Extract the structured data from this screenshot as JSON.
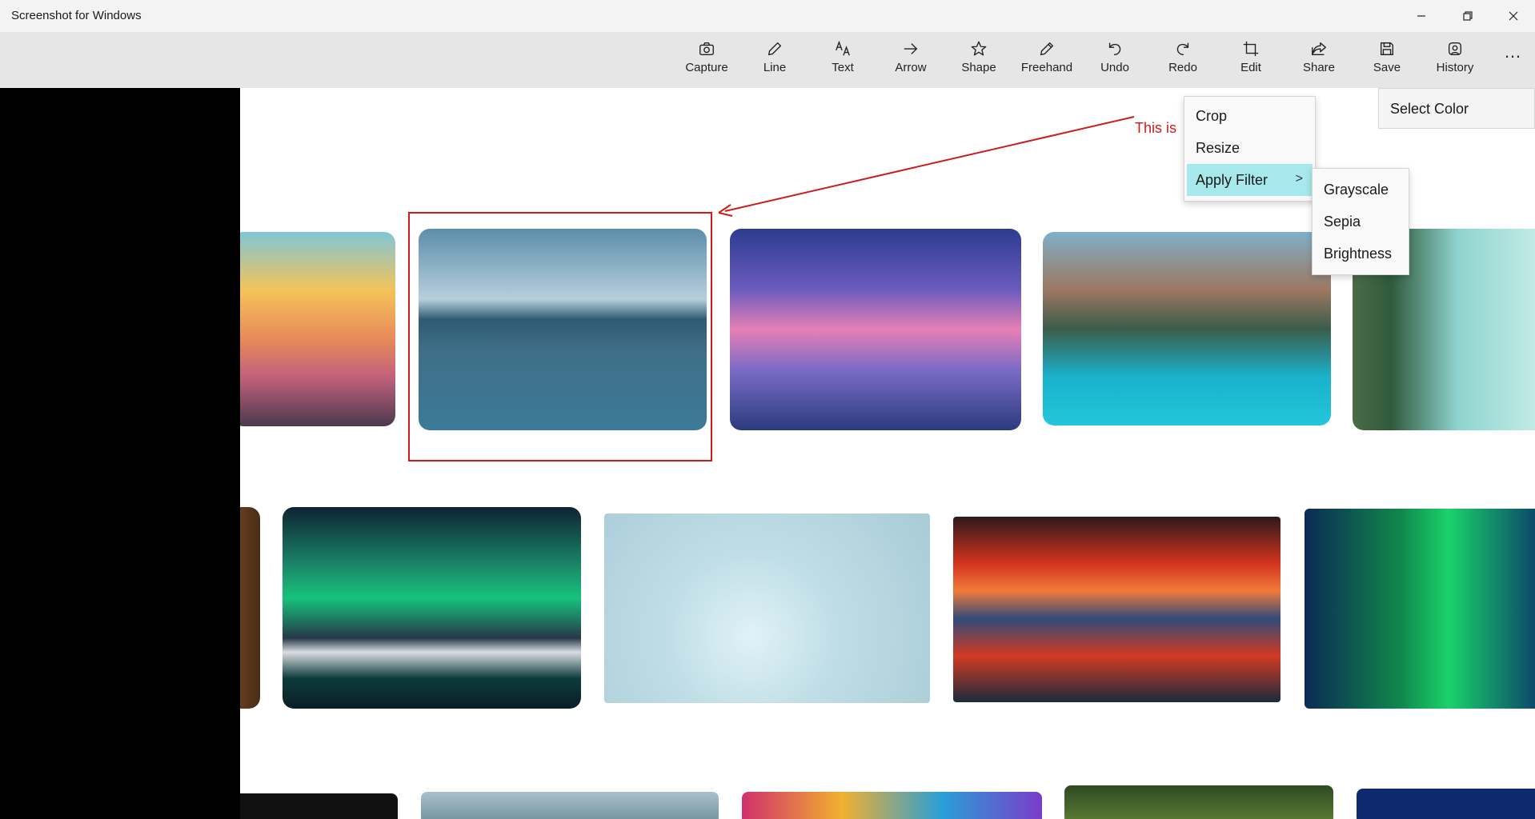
{
  "window": {
    "title": "Screenshot for Windows",
    "controls": [
      "minimize-icon",
      "restore-icon",
      "close-icon"
    ]
  },
  "toolbar": {
    "items": [
      {
        "label": "Capture",
        "icon": "camera-icon"
      },
      {
        "label": "Line",
        "icon": "pencil-icon"
      },
      {
        "label": "Text",
        "icon": "text-icon"
      },
      {
        "label": "Arrow",
        "icon": "arrow-right-icon"
      },
      {
        "label": "Shape",
        "icon": "star-icon"
      },
      {
        "label": "Freehand",
        "icon": "pen-icon"
      },
      {
        "label": "Undo",
        "icon": "undo-icon"
      },
      {
        "label": "Redo",
        "icon": "redo-icon"
      },
      {
        "label": "Edit",
        "icon": "crop-icon"
      },
      {
        "label": "Share",
        "icon": "share-icon"
      },
      {
        "label": "Save",
        "icon": "save-icon"
      },
      {
        "label": "History",
        "icon": "history-icon"
      }
    ],
    "more": "…"
  },
  "annotation": {
    "text": "This is",
    "color": "#d01a1a"
  },
  "context_menu": {
    "items": [
      "Crop",
      "Resize",
      "Apply Filter"
    ],
    "submenu_chevron": ">",
    "filter_submenu": [
      "Grayscale",
      "Sepia",
      "Brightness"
    ]
  },
  "select_color": {
    "label": "Select Color"
  },
  "colors": {
    "accent_highlight": "#a7e8ec",
    "annotation_red": "#d01a1a",
    "toolbar_bg": "#e6e6e6",
    "titlebar_bg": "#f3f3f3"
  }
}
